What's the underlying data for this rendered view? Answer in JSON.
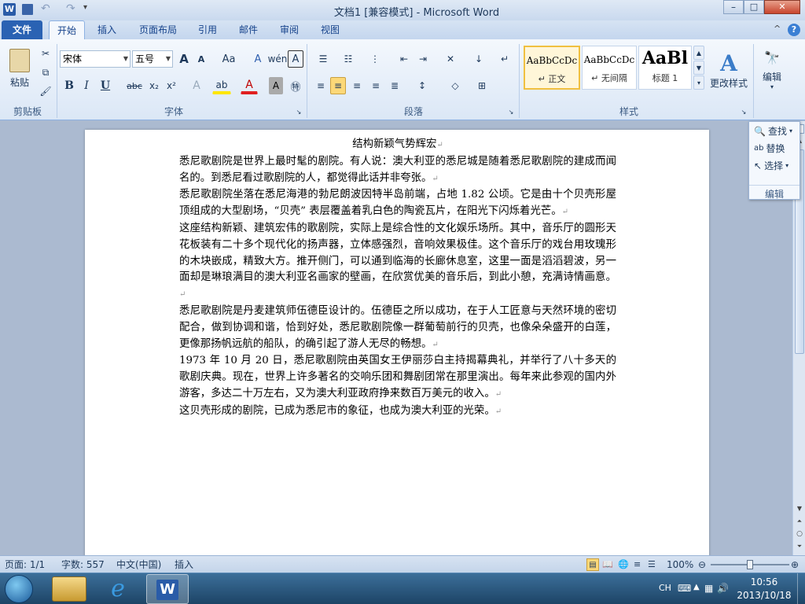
{
  "titlebar": {
    "title": "文档1 [兼容模式] - Microsoft Word"
  },
  "qat": {
    "undo": "↶",
    "redo": "↷"
  },
  "tabs": [
    "文件",
    "开始",
    "插入",
    "页面布局",
    "引用",
    "邮件",
    "审阅",
    "视图"
  ],
  "ribbon": {
    "clipboard": {
      "paste": "粘贴",
      "group": "剪贴板"
    },
    "font": {
      "name": "宋体",
      "size": "五号",
      "group": "字体",
      "grow": "A",
      "shrink": "A",
      "change_case": "Aa",
      "bold": "B",
      "italic": "I",
      "underline": "U",
      "strike": "abc",
      "sub": "x₂",
      "sup": "x²",
      "color": "A"
    },
    "paragraph": {
      "group": "段落"
    },
    "styles": {
      "group": "样式",
      "items": [
        {
          "preview": "AaBbCcDc",
          "name": "↵ 正文"
        },
        {
          "preview": "AaBbCcDc",
          "name": "↵ 无间隔"
        },
        {
          "preview": "AaBl",
          "name": "标题 1"
        }
      ],
      "change": "更改样式"
    },
    "editing": {
      "label": "编辑",
      "group": "编辑",
      "find": "查找",
      "replace": "替换",
      "select": "选择"
    }
  },
  "document": {
    "title": "结构新颖气势辉宏",
    "paragraphs": [
      "悉尼歌剧院是世界上最时髦的剧院。有人说：澳大利亚的悉尼城是随着悉尼歌剧院的建成而闻名的。到悉尼看过歌剧院的人，都觉得此话并非夸张。",
      "悉尼歌剧院坐落在悉尼海港的勃尼朗波因特半岛前端，占地 1.82 公顷。它是由十个贝壳形屋顶组成的大型剧场，“贝壳” 表层覆盖着乳白色的陶瓷瓦片，在阳光下闪烁着光芒。",
      "这座结构新颖、建筑宏伟的歌剧院，实际上是综合性的文化娱乐场所。其中，音乐厅的圆形天花板装有二十多个现代化的扬声器，立体感强烈，音响效果极佳。这个音乐厅的戏台用玫瑰形的木块嵌成，精致大方。推开侧门，可以通到临海的长廊休息室，这里一面是滔滔碧波，另一面却是琳琅满目的澳大利亚名画家的壁画，在欣赏优美的音乐后，到此小憩，充满诗情画意。",
      "悉尼歌剧院是丹麦建筑师伍德臣设计的。伍德臣之所以成功，在于人工匠意与天然环境的密切配合，做到协调和谐，恰到好处，悉尼歌剧院像一群葡萄前行的贝壳，也像朵朵盛开的白莲，更像那扬帆远航的船队，的确引起了游人无尽的畅想。",
      "1973 年 10 月 20 日，悉尼歌剧院由英国女王伊丽莎白主持揭幕典礼，并举行了八十多天的歌剧庆典。现在，世界上许多著名的交响乐团和舞剧团常在那里演出。每年来此参观的国内外游客，多达二十万左右，又为澳大利亚政府挣来数百万美元的收入。",
      "这贝壳形成的剧院，已成为悉尼市的象征，也成为澳大利亚的光荣。"
    ]
  },
  "status": {
    "page": "页面: 1/1",
    "words": "字数: 557",
    "lang": "中文(中国)",
    "mode": "插入",
    "zoom": "100%"
  },
  "taskbar": {
    "ime": "CH",
    "time": "10:56",
    "date": "2013/10/18"
  },
  "window_controls": {
    "min": "–",
    "max": "□",
    "close": "✕"
  }
}
